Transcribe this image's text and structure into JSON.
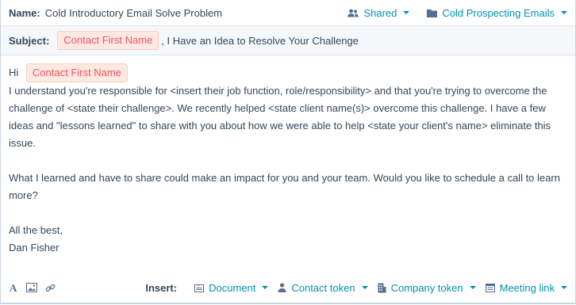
{
  "header": {
    "name_label": "Name:",
    "name_value": "Cold Introductory Email Solve Problem",
    "shared_label": "Shared",
    "folder_label": "Cold Prospecting Emails"
  },
  "subject": {
    "label": "Subject:",
    "token": "Contact First Name",
    "text": ", I Have an Idea to Resolve Your Challenge"
  },
  "body": {
    "greeting": "Hi",
    "token": "Contact First Name",
    "paragraph1": "I understand you're responsible for <insert their job function, role/responsibility>  and that you're trying to overcome the challenge of <state their challenge>.  We recently helped <state client name(s)> overcome this challenge.  I have a few ideas and \"lessons learned\" to share with you about how we were able to help <state your client's name> eliminate this issue.",
    "paragraph2": "What I learned and have to share could make an impact for you and your team. Would you like to schedule a call to learn more?",
    "signoff": "All the best,",
    "signature": "Dan Fisher"
  },
  "toolbar": {
    "insert_label": "Insert:",
    "document_label": "Document",
    "contact_token_label": "Contact token",
    "company_token_label": "Company token",
    "meeting_link_label": "Meeting link"
  },
  "icons": {
    "shared": "users-icon",
    "folder": "folder-icon",
    "text_format": "text-format-icon",
    "image": "image-icon",
    "link": "link-icon",
    "document": "document-icon",
    "contact": "person-icon",
    "company": "building-icon",
    "meeting": "calendar-icon"
  },
  "colors": {
    "link": "#0091ae",
    "token_bg": "#fde8e2",
    "token_text": "#f2545b",
    "text": "#33475b",
    "subject_bg": "#f5f8fa"
  }
}
